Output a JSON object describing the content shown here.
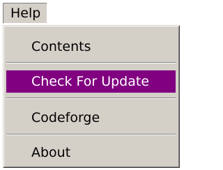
{
  "menubar": {
    "help_label": "Help"
  },
  "help_menu": {
    "items": [
      {
        "label": "Contents",
        "highlighted": false
      },
      {
        "label": "Check For Update",
        "highlighted": true
      },
      {
        "label": "Codeforge",
        "highlighted": false
      },
      {
        "label": "About",
        "highlighted": false
      }
    ]
  },
  "colors": {
    "menu_background": "#d4d0c8",
    "highlight_background": "#800080",
    "highlight_text": "#ffffff",
    "text": "#000000"
  }
}
